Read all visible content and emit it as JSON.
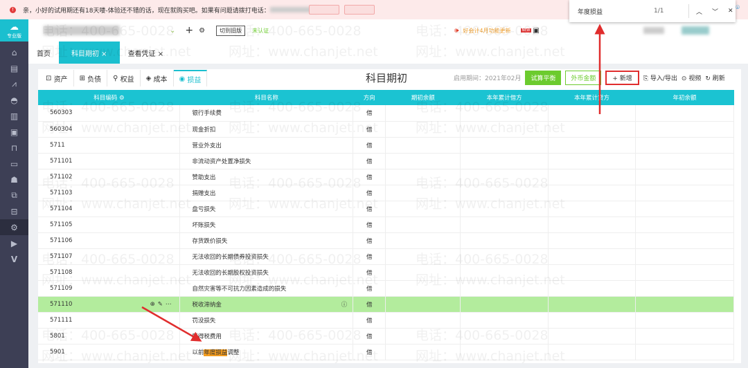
{
  "banner": {
    "text": "亲，小好的试用期还有18天喽-体验还不错的话，现在就购买吧。如果有问题请拨打电话："
  },
  "header": {
    "logo": "专业版",
    "switch_label": "切到旧版",
    "status": "未认证",
    "notice": "好会计4月功能更新",
    "new_badge": "NEW"
  },
  "tabs": [
    {
      "label": "首页"
    },
    {
      "label": "科目期初 ×"
    },
    {
      "label": "查看凭证 ×"
    }
  ],
  "subtabs": [
    {
      "label": "资产"
    },
    {
      "label": "负债"
    },
    {
      "label": "权益"
    },
    {
      "label": "成本"
    },
    {
      "label": "损益"
    }
  ],
  "page": {
    "title": "科目期初",
    "start_period": "启用期间：2021年02月",
    "trial_balance": "试算平衡",
    "foreign": "外币金额",
    "new": "+ 新增",
    "import_export": "导入/导出",
    "video": "视频",
    "refresh": "刷新"
  },
  "find": {
    "query": "年度损益",
    "count": "1/1"
  },
  "table": {
    "headers": [
      "科目编码",
      "科目名称",
      "方向",
      "期初余额",
      "本年累计借方",
      "本年累计贷方",
      "年初余额"
    ],
    "rows": [
      {
        "code": "560303",
        "name": "银行手续费",
        "dir": "借"
      },
      {
        "code": "560304",
        "name": "现金折扣",
        "dir": "借"
      },
      {
        "code": "5711",
        "name": "营业外支出",
        "dir": "借"
      },
      {
        "code": "571101",
        "name": "非流动资产处置净损失",
        "dir": "借"
      },
      {
        "code": "571102",
        "name": "赞助支出",
        "dir": "借"
      },
      {
        "code": "571103",
        "name": "捐赠支出",
        "dir": "借"
      },
      {
        "code": "571104",
        "name": "盘亏损失",
        "dir": "借"
      },
      {
        "code": "571105",
        "name": "坏账损失",
        "dir": "借"
      },
      {
        "code": "571106",
        "name": "存货跌价损失",
        "dir": "借"
      },
      {
        "code": "571107",
        "name": "无法收回的长期债券投资损失",
        "dir": "借"
      },
      {
        "code": "571108",
        "name": "无法收回的长期股权投资损失",
        "dir": "借"
      },
      {
        "code": "571109",
        "name": "自然灾害等不可抗力因素造成的损失",
        "dir": "借"
      },
      {
        "code": "571110",
        "name": "税收滞纳金",
        "dir": "借"
      },
      {
        "code": "571111",
        "name": "罚没损失",
        "dir": "借"
      },
      {
        "code": "5801",
        "name": "所得税费用",
        "dir": "借"
      },
      {
        "code": "5901",
        "name_pre": "以前",
        "name_hl": "年度损益",
        "name_post": "调整",
        "dir": "借"
      }
    ]
  },
  "watermark": {
    "phone": "电话：400-665-0028",
    "site": "网址：www.chanjet.net"
  },
  "colors": {
    "accent": "#1bbfcf",
    "selected_row": "#b3ec9d",
    "highlight": "#f39c1f",
    "arrow": "#e02d2d"
  }
}
